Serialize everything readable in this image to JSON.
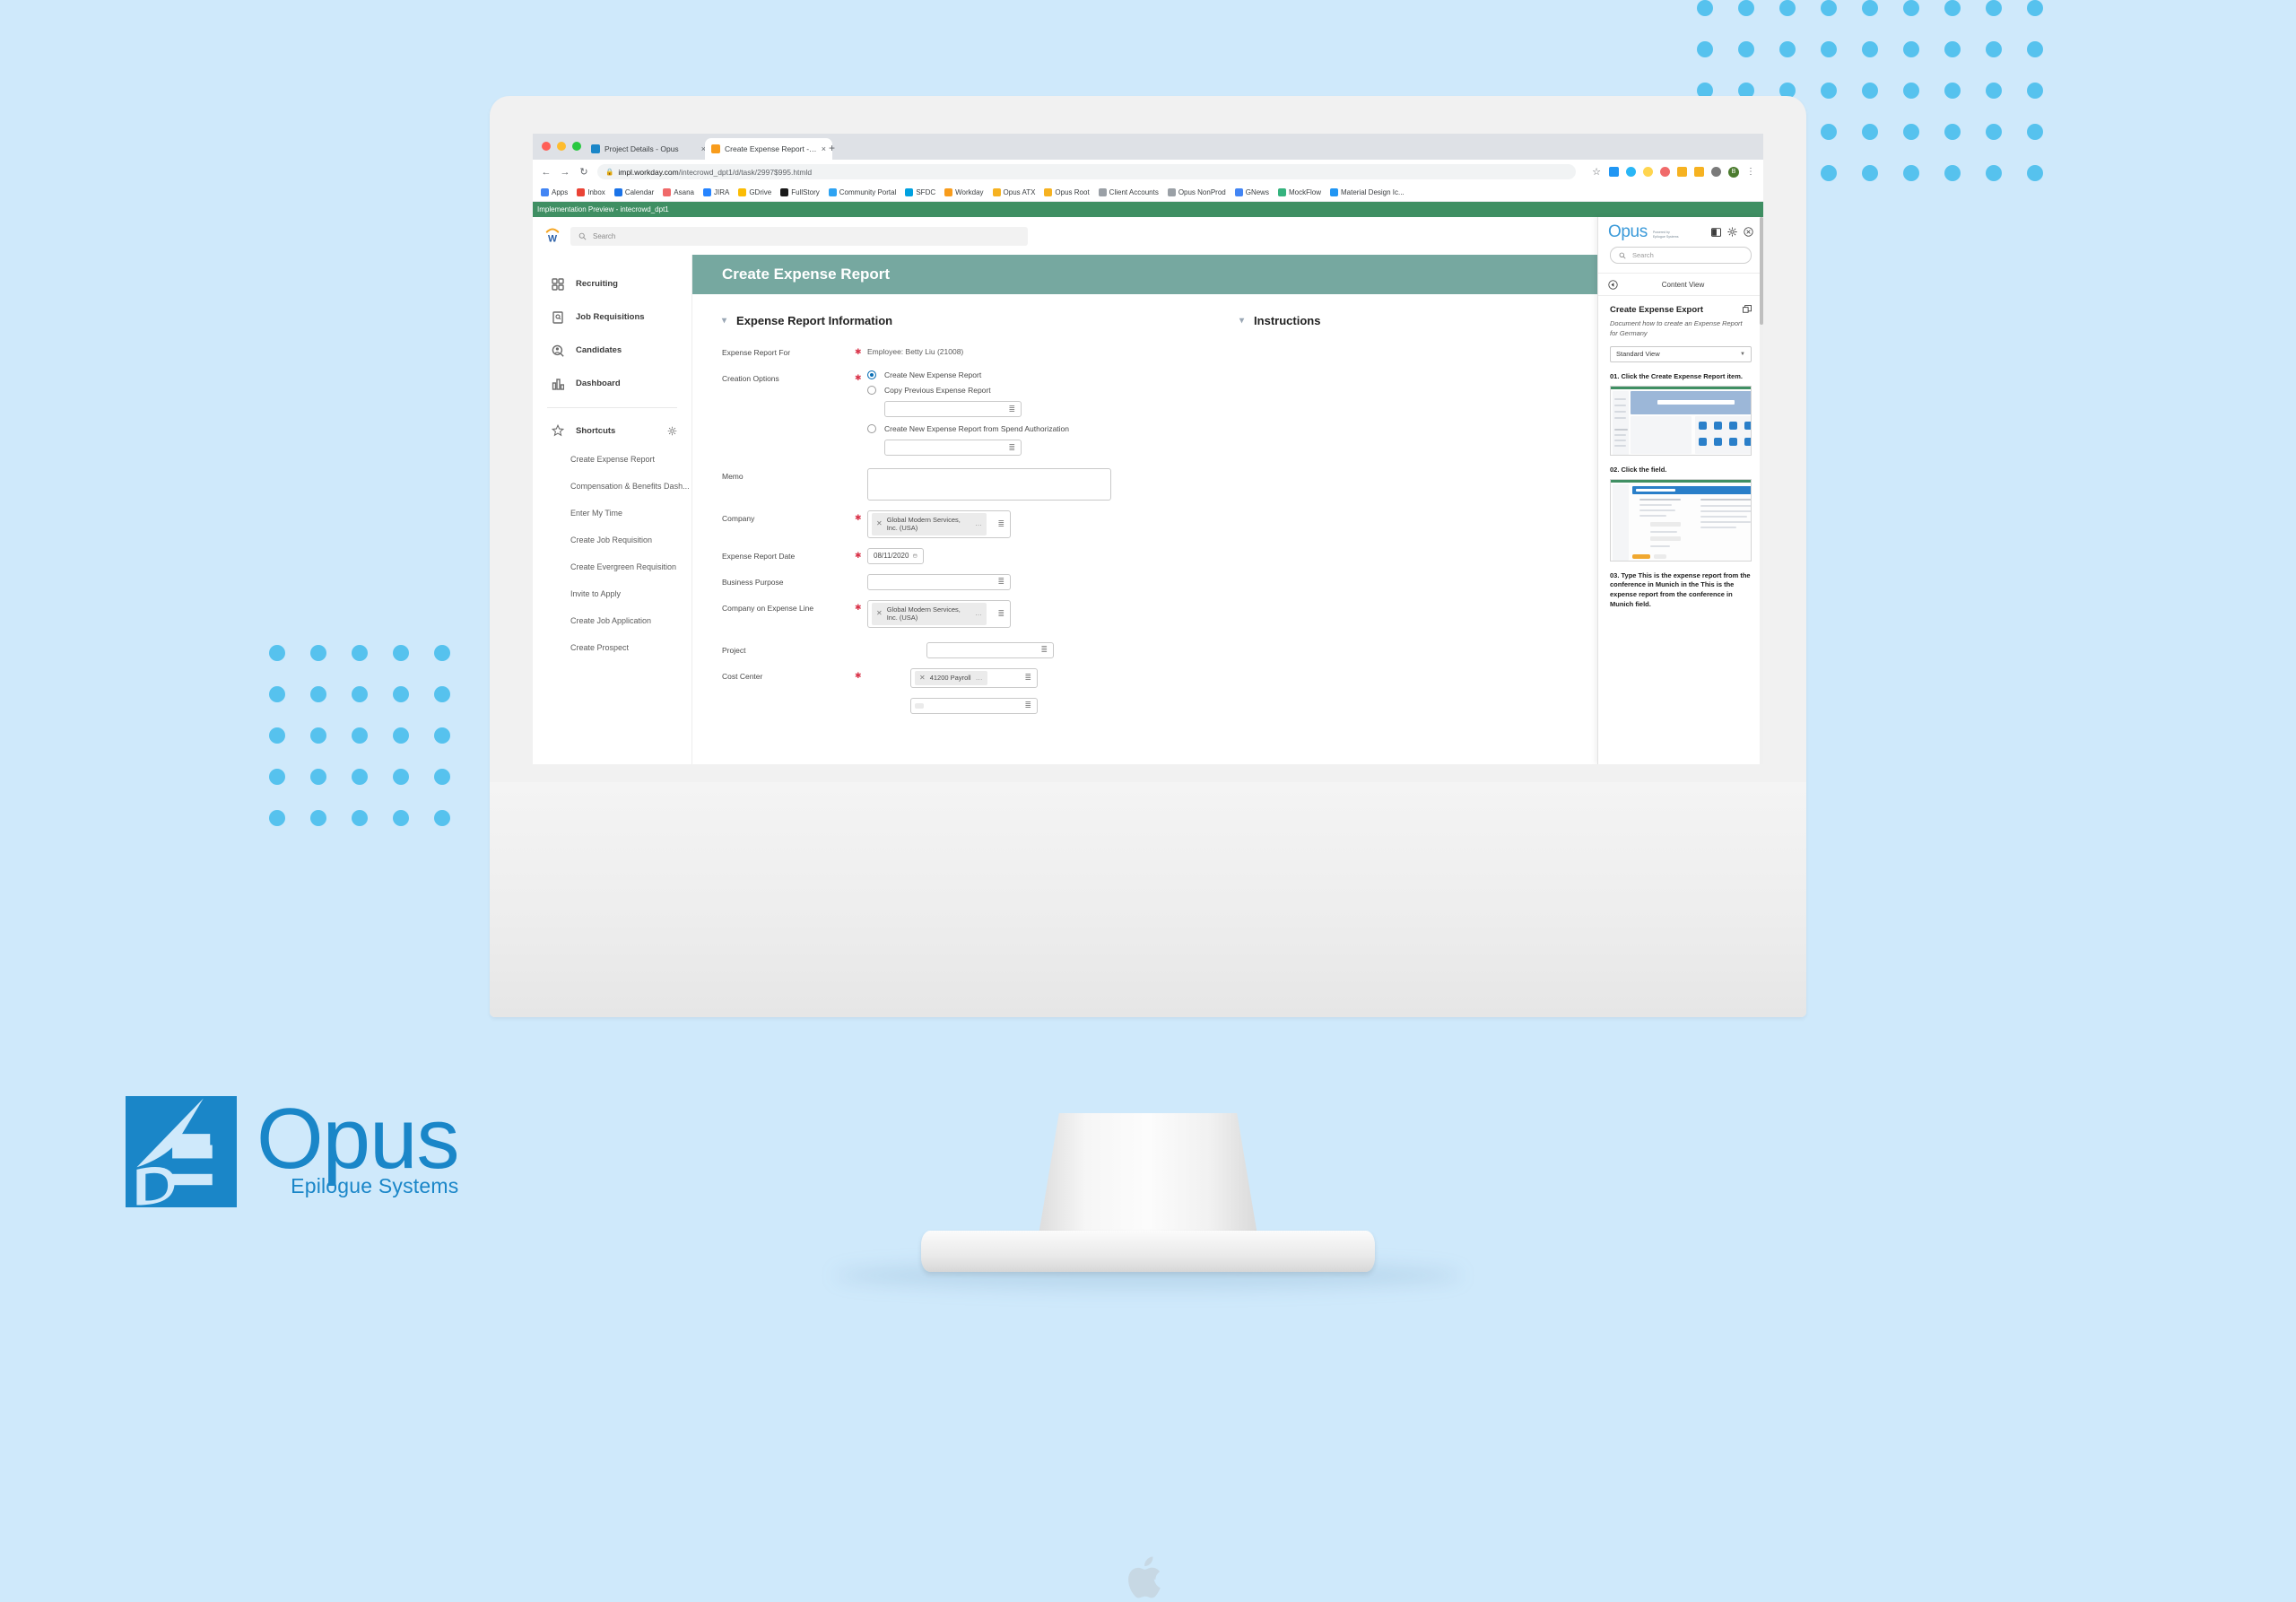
{
  "background": {
    "color": "#cfe9fb",
    "dot_color": "#56c2ee"
  },
  "browser": {
    "tabs": [
      {
        "title": "Project Details - Opus",
        "active": false,
        "favicon_color": "#1a86c8"
      },
      {
        "title": "Create Expense Report - Work",
        "active": true,
        "favicon_color": "#f89c1c"
      }
    ],
    "new_tab_label": "+",
    "close_label": "×",
    "nav": {
      "back": "←",
      "forward": "→",
      "reload": "↻"
    },
    "url_host": "impl.workday.com",
    "url_path": "/intecrowd_dpt1/d/task/2997$995.htmld",
    "lock_icon": "lock-icon",
    "star_icon": "star-icon",
    "avatar_initial": "B",
    "kebab": "⋮",
    "bookmarks": [
      {
        "label": "Apps",
        "color": "#4285f4"
      },
      {
        "label": "Inbox",
        "color": "#ea4335"
      },
      {
        "label": "Calendar",
        "color": "#1a73e8"
      },
      {
        "label": "Asana",
        "color": "#f06a6a"
      },
      {
        "label": "JIRA",
        "color": "#2684ff"
      },
      {
        "label": "GDrive",
        "color": "#fbbc04"
      },
      {
        "label": "FullStory",
        "color": "#1a1a1a"
      },
      {
        "label": "Community Portal",
        "color": "#2ea3f2"
      },
      {
        "label": "SFDC",
        "color": "#00a1e0"
      },
      {
        "label": "Workday",
        "color": "#f89c1c"
      },
      {
        "label": "Opus ATX",
        "color": "#f6b221"
      },
      {
        "label": "Opus Root",
        "color": "#f6b221"
      },
      {
        "label": "Client Accounts",
        "color": "#9aa0a6"
      },
      {
        "label": "Opus NonProd",
        "color": "#9aa0a6"
      },
      {
        "label": "GNews",
        "color": "#4285f4"
      },
      {
        "label": "MockFlow",
        "color": "#35b37e"
      },
      {
        "label": "Material Design Ic...",
        "color": "#2196f3"
      }
    ]
  },
  "workday": {
    "preview_banner": "Implementation Preview - intecrowd_dpt1",
    "search_placeholder": "Search",
    "nav_items": [
      {
        "label": "Recruiting",
        "icon": "grid-icon"
      },
      {
        "label": "Job Requisitions",
        "icon": "document-search-icon"
      },
      {
        "label": "Candidates",
        "icon": "person-search-icon"
      },
      {
        "label": "Dashboard",
        "icon": "bar-chart-icon"
      }
    ],
    "shortcuts_heading": "Shortcuts",
    "shortcuts_icon": "star-icon",
    "shortcuts_gear": "gear-icon",
    "shortcuts": [
      "Create Expense Report",
      "Compensation & Benefits Dash...",
      "Enter My Time",
      "Create Job Requisition",
      "Create Evergreen Requisition",
      "Invite to Apply",
      "Create Job Application",
      "Create Prospect"
    ],
    "page_title": "Create Expense Report",
    "header_color": "#76a8a0",
    "section_title": "Expense Report Information",
    "instructions_title": "Instructions",
    "fields": {
      "expense_report_for": {
        "label": "Expense Report For",
        "value": "Employee: Betty Liu (21008)",
        "required": true
      },
      "creation_options": {
        "label": "Creation Options",
        "required": true,
        "options": [
          {
            "label": "Create New Expense Report",
            "selected": true
          },
          {
            "label": "Copy Previous Expense Report",
            "selected": false,
            "input_value": ""
          },
          {
            "label": "Create New Expense Report from Spend Authorization",
            "selected": false,
            "input_value": ""
          }
        ]
      },
      "memo": {
        "label": "Memo",
        "value": "",
        "required": false
      },
      "company": {
        "label": "Company",
        "value": "Global Modern Services, Inc. (USA)",
        "required": true
      },
      "expense_report_date": {
        "label": "Expense Report Date",
        "value": "08/11/2020",
        "required": true,
        "icon": "calendar-icon"
      },
      "business_purpose": {
        "label": "Business Purpose",
        "value": "",
        "required": false
      },
      "company_on_expense_line": {
        "label": "Company on Expense Line",
        "value": "Global Modern Services, Inc. (USA)",
        "required": true
      },
      "project": {
        "label": "Project",
        "value": "",
        "required": false
      },
      "cost_center": {
        "label": "Cost Center",
        "value": "41200 Payroll",
        "required": true
      }
    }
  },
  "opus_panel": {
    "logo_text": "Opus",
    "logo_sub_line1": "Powered by",
    "logo_sub_line2": "Epilogue Systems",
    "controls": [
      {
        "name": "panel-layout-icon"
      },
      {
        "name": "gear-icon"
      },
      {
        "name": "close-icon"
      }
    ],
    "search_placeholder": "Search",
    "content_view_label": "Content View",
    "back_icon": "back-circle-icon",
    "doc_title": "Create Expense Export",
    "popout_icon": "popout-icon",
    "doc_description": "Document how to create an Expense Report for Germany",
    "view_select": "Standard View",
    "steps": [
      {
        "text": "01. Click the Create Expense Report item."
      },
      {
        "text": "02. Click the field."
      },
      {
        "text": "03. Type This is the expense report from the conference in Munich in the This is the expense report from the conference in Munich field."
      }
    ]
  },
  "brand": {
    "name": "Opus",
    "tagline": "Epilogue Systems",
    "color": "#1a86c8"
  }
}
